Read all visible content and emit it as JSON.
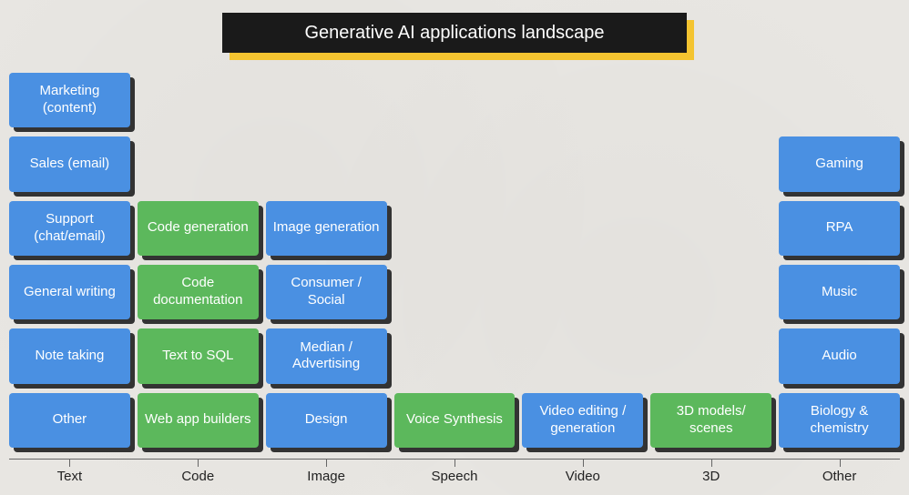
{
  "title": "Generative AI applications landscape",
  "colors": {
    "blue": "#4a90e2",
    "green": "#5cb85c",
    "titleBg": "#1a1a1a",
    "titleAccent": "#f4c430"
  },
  "columns": [
    "Text",
    "Code",
    "Image",
    "Speech",
    "Video",
    "3D",
    "Other"
  ],
  "cells": [
    {
      "col": 1,
      "row": 1,
      "color": "blue",
      "label": "Marketing (content)"
    },
    {
      "col": 1,
      "row": 2,
      "color": "blue",
      "label": "Sales (email)"
    },
    {
      "col": 1,
      "row": 3,
      "color": "blue",
      "label": "Support (chat/email)"
    },
    {
      "col": 1,
      "row": 4,
      "color": "blue",
      "label": "General writing"
    },
    {
      "col": 1,
      "row": 5,
      "color": "blue",
      "label": "Note taking"
    },
    {
      "col": 1,
      "row": 6,
      "color": "blue",
      "label": "Other"
    },
    {
      "col": 2,
      "row": 3,
      "color": "green",
      "label": "Code generation"
    },
    {
      "col": 2,
      "row": 4,
      "color": "green",
      "label": "Code documentation"
    },
    {
      "col": 2,
      "row": 5,
      "color": "green",
      "label": "Text to SQL"
    },
    {
      "col": 2,
      "row": 6,
      "color": "green",
      "label": "Web app builders"
    },
    {
      "col": 3,
      "row": 3,
      "color": "blue",
      "label": "Image generation"
    },
    {
      "col": 3,
      "row": 4,
      "color": "blue",
      "label": "Consumer / Social"
    },
    {
      "col": 3,
      "row": 5,
      "color": "blue",
      "label": "Median / Advertising"
    },
    {
      "col": 3,
      "row": 6,
      "color": "blue",
      "label": "Design"
    },
    {
      "col": 4,
      "row": 6,
      "color": "green",
      "label": "Voice Synthesis"
    },
    {
      "col": 5,
      "row": 6,
      "color": "blue",
      "label": "Video editing / generation"
    },
    {
      "col": 6,
      "row": 6,
      "color": "green",
      "label": "3D models/ scenes"
    },
    {
      "col": 7,
      "row": 2,
      "color": "blue",
      "label": "Gaming"
    },
    {
      "col": 7,
      "row": 3,
      "color": "blue",
      "label": "RPA"
    },
    {
      "col": 7,
      "row": 4,
      "color": "blue",
      "label": "Music"
    },
    {
      "col": 7,
      "row": 5,
      "color": "blue",
      "label": "Audio"
    },
    {
      "col": 7,
      "row": 6,
      "color": "blue",
      "label": "Biology & chemistry"
    }
  ]
}
